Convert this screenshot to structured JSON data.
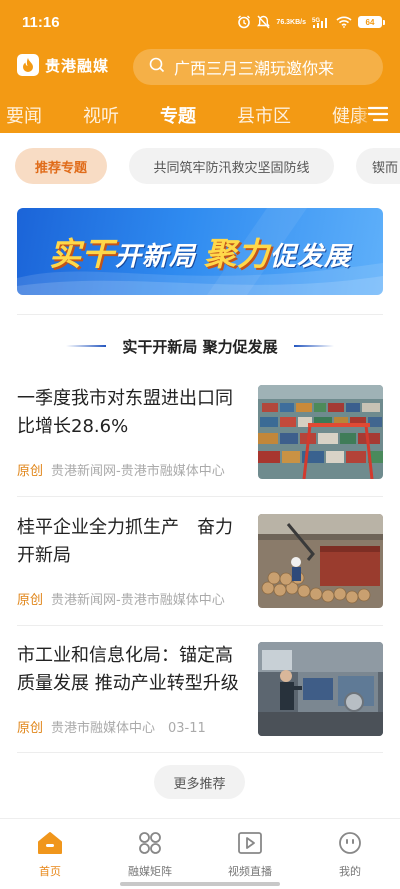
{
  "status": {
    "time": "11:16",
    "net_speed_top": "76.3",
    "net_speed_unit": "KB/s",
    "signal_label": "5G",
    "battery": "64"
  },
  "header": {
    "app_name": "贵港融媒",
    "search_placeholder": "广西三月三潮玩邀你来",
    "tabs": [
      {
        "label": "要闻"
      },
      {
        "label": "视听"
      },
      {
        "label": "专题",
        "active": true
      },
      {
        "label": "县市区"
      },
      {
        "label": "健康"
      }
    ]
  },
  "chips": [
    {
      "label": "推荐专题",
      "active": true
    },
    {
      "label": "共同筑牢防汛救灾坚固防线"
    },
    {
      "label": "锲而"
    }
  ],
  "banner": {
    "part1": "实干",
    "part2": "开新局",
    "part3": "聚力",
    "part4": "促发展"
  },
  "section": {
    "title": "实干开新局 聚力促发展"
  },
  "news": [
    {
      "title": "一季度我市对东盟进出口同比增长28.6%",
      "tag": "原创",
      "source": "贵港新闻网-贵港市融媒体中心",
      "thumb": "container-port-image"
    },
    {
      "title": "桂平企业全力抓生产　奋力开新局",
      "tag": "原创",
      "source": "贵港新闻网-贵港市融媒体中心",
      "thumb": "timber-factory-image"
    },
    {
      "title": "市工业和信息化局：锚定高质量发展 推动产业转型升级",
      "tag": "原创",
      "source": "贵港市融媒体中心　03-11",
      "thumb": "industrial-workshop-image"
    }
  ],
  "more_button": "更多推荐",
  "bottom_nav": [
    {
      "label": "首页",
      "icon": "home-icon",
      "active": true
    },
    {
      "label": "融媒矩阵",
      "icon": "grid-icon"
    },
    {
      "label": "视频直播",
      "icon": "video-play-icon"
    },
    {
      "label": "我的",
      "icon": "profile-face-icon"
    }
  ],
  "colors": {
    "brand": "#f39a14",
    "chip_active_bg": "#f8dcc4",
    "chip_active_text": "#e06c1a",
    "tag": "#e0861a"
  }
}
